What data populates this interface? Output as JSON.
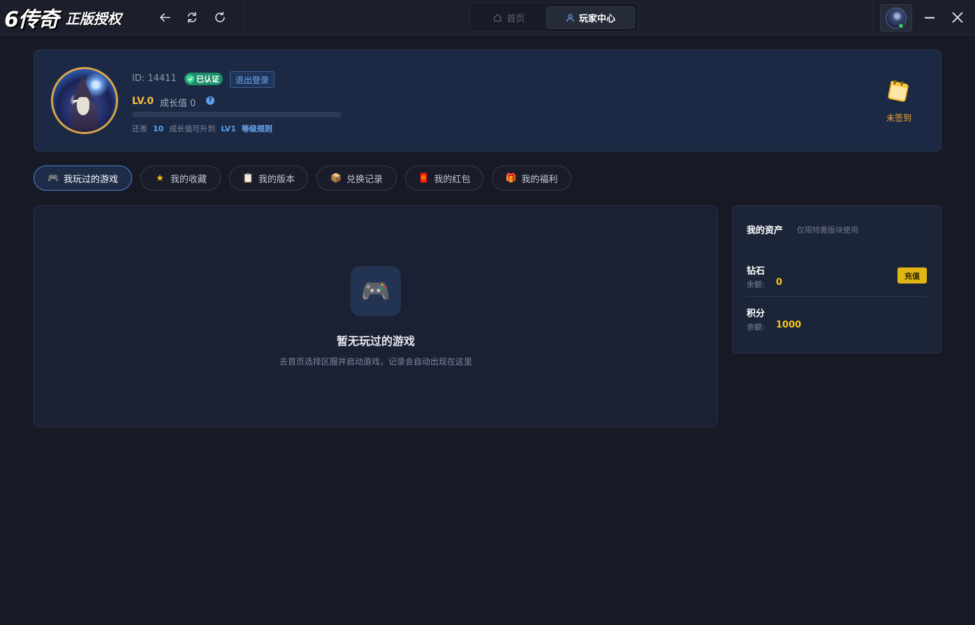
{
  "titlebar": {
    "logo_main": "6传奇",
    "logo_sub": "正版授权",
    "tabs": [
      {
        "label": "首页",
        "icon": "home-icon"
      },
      {
        "label": "玩家中心",
        "icon": "user-icon"
      }
    ]
  },
  "profile": {
    "id_text": "ID: 14411",
    "verified_label": "已认证",
    "logout_label": "退出登录",
    "level": "LV.0",
    "growth_label": "成长值 0",
    "help_glyph": "?",
    "progress": 0,
    "hint_prefix": "还差",
    "hint_amount": "10",
    "hint_middle": "成长值可升到",
    "hint_next_level": "LV1",
    "rules_link": "等级规则",
    "signin_label": "未签到"
  },
  "filter_tabs": [
    {
      "label": "我玩过的游戏",
      "icon": "gamepad-icon",
      "glyph": "🎮"
    },
    {
      "label": "我的收藏",
      "icon": "star-icon",
      "glyph": "★"
    },
    {
      "label": "我的版本",
      "icon": "clipboard-icon",
      "glyph": "📋"
    },
    {
      "label": "兑换记录",
      "icon": "package-icon",
      "glyph": "📦"
    },
    {
      "label": "我的红包",
      "icon": "red-envelope-icon",
      "glyph": "🧧"
    },
    {
      "label": "我的福利",
      "icon": "gift-icon",
      "glyph": "🎁"
    }
  ],
  "games_panel": {
    "empty_glyph": "🎮",
    "empty_title": "暂无玩过的游戏",
    "empty_subtitle": "去首页选择区服并启动游戏，记录会自动出现在这里"
  },
  "assets": {
    "title": "我的资产",
    "note": "仅限特惠版块使用",
    "items": [
      {
        "name": "钻石",
        "balance_label": "余额:",
        "balance": "0",
        "action_label": "充值"
      },
      {
        "name": "积分",
        "balance_label": "余额:",
        "balance": "1000"
      }
    ]
  },
  "colors": {
    "background": "#171a24",
    "card": "#1c2944",
    "accent_blue": "#5aa0f0",
    "gold": "#f5c518",
    "level_gold": "#f3bd3c",
    "verified_green": "#1d8f6a"
  }
}
